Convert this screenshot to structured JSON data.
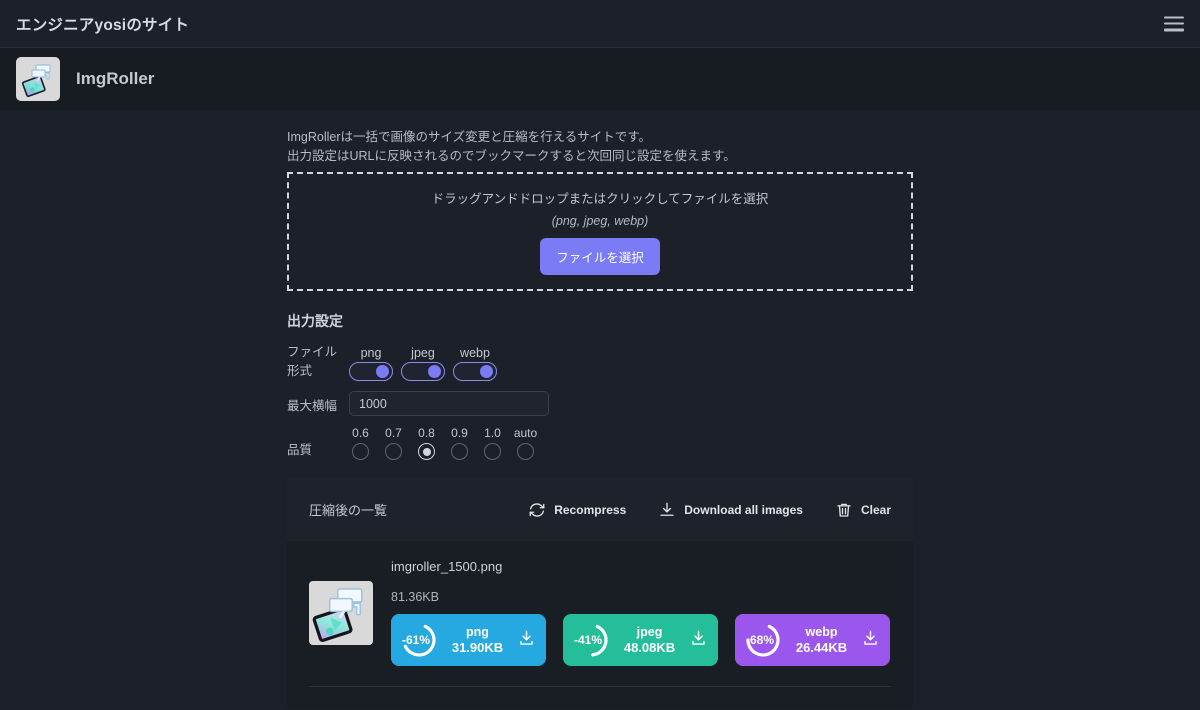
{
  "titlebar": {
    "site_title": "エンジニアyosiのサイト",
    "menu_icon": "hamburger-icon"
  },
  "appbar": {
    "app_name": "ImgRoller",
    "logo_icon": "imgroller-logo-icon"
  },
  "description": {
    "line1": "ImgRollerは一括で画像のサイズ変更と圧縮を行えるサイトです。",
    "line2": "出力設定はURLに反映されるのでブックマークすると次回同じ設定を使えます。"
  },
  "dropzone": {
    "main_text": "ドラッグアンドドロップまたはクリックしてファイルを選択",
    "sub_text": "(png, jpeg, webp)",
    "button_label": "ファイルを選択"
  },
  "settings": {
    "title": "出力設定",
    "format_label": "ファイル形式",
    "formats": [
      {
        "label": "png",
        "on": true
      },
      {
        "label": "jpeg",
        "on": true
      },
      {
        "label": "webp",
        "on": true
      }
    ],
    "max_width_label": "最大横幅",
    "max_width_value": "1000",
    "max_width_placeholder": "1000",
    "quality_label": "品質",
    "quality_options": [
      "0.6",
      "0.7",
      "0.8",
      "0.9",
      "1.0",
      "auto"
    ],
    "quality_selected": "0.8"
  },
  "results": {
    "title": "圧縮後の一覧",
    "actions": [
      {
        "label": "Recompress",
        "icon": "refresh-icon"
      },
      {
        "label": "Download all images",
        "icon": "download-icon"
      },
      {
        "label": "Clear",
        "icon": "trash-icon"
      }
    ],
    "files": [
      {
        "name": "imgroller_1500.png",
        "size": "81.36KB",
        "outputs": [
          {
            "format": "png",
            "percent": "-61%",
            "size": "31.90KB",
            "color": "#25a9e0",
            "ring_fraction": 0.61
          },
          {
            "format": "jpeg",
            "percent": "-41%",
            "size": "48.08KB",
            "color": "#24bf9a",
            "ring_fraction": 0.41
          },
          {
            "format": "webp",
            "percent": "-68%",
            "size": "26.44KB",
            "color": "#9b56ee",
            "ring_fraction": 0.68
          }
        ]
      }
    ]
  },
  "colors": {
    "page_bg": "#1c2028",
    "appbar_bg": "#171b22",
    "panel_bg": "#191d24",
    "panel_head_bg": "#1e232b",
    "accent_purple": "#7b7bf5",
    "png_blue": "#25a9e0",
    "jpeg_green": "#24bf9a",
    "webp_purple": "#9b56ee"
  }
}
